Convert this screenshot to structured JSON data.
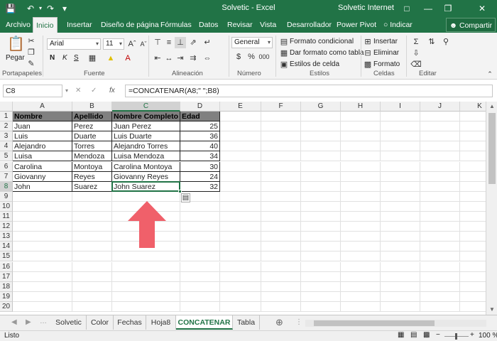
{
  "titlebar": {
    "title": "Solvetic  -  Excel",
    "account": "Solvetic Internet",
    "help_icon": "?",
    "ribbon_display_icon": "ribbon-display-icon"
  },
  "tabs": [
    "Archivo",
    "Inicio",
    "Insertar",
    "Diseño de página",
    "Fórmulas",
    "Datos",
    "Revisar",
    "Vista",
    "Desarrollador",
    "Power Pivot",
    "Indicar"
  ],
  "active_tab": "Inicio",
  "share_label": "Compartir",
  "ribbon": {
    "clipboard": {
      "paste": "Pegar",
      "label": "Portapapeles"
    },
    "font": {
      "name": "Arial",
      "size": "11",
      "bold": "N",
      "italic": "K",
      "underline": "S",
      "label": "Fuente"
    },
    "alignment": {
      "label": "Alineación"
    },
    "number": {
      "format": "General",
      "label": "Número"
    },
    "styles": {
      "conditional": "Formato condicional",
      "table": "Dar formato como tabla",
      "cell": "Estilos de celda",
      "label": "Estilos"
    },
    "cells": {
      "insert": "Insertar",
      "delete": "Eliminar",
      "format": "Formato",
      "label": "Celdas"
    },
    "editing": {
      "label": "Editar"
    }
  },
  "formula_bar": {
    "name_box": "C8",
    "fx": "fx",
    "formula": "=CONCATENAR(A8;\" \";B8)"
  },
  "columns": [
    "A",
    "B",
    "C",
    "D",
    "E",
    "F",
    "G",
    "H",
    "I",
    "J",
    "K"
  ],
  "rows": [
    "1",
    "2",
    "3",
    "4",
    "5",
    "6",
    "7",
    "8",
    "9",
    "10",
    "11",
    "12",
    "13",
    "14",
    "15",
    "16",
    "17",
    "18",
    "19",
    "20"
  ],
  "table": {
    "headers": [
      "Nombre",
      "Apellido",
      "Nombre Completo",
      "Edad"
    ],
    "data": [
      [
        "Juan",
        "Perez",
        "Juan Perez",
        "25"
      ],
      [
        "Luis",
        "Duarte",
        "Luis  Duarte",
        "36"
      ],
      [
        "Alejandro",
        "Torres",
        "Alejandro  Torres",
        "40"
      ],
      [
        "Luisa",
        "Mendoza",
        "Luisa  Mendoza",
        "34"
      ],
      [
        "Carolina",
        "Montoya",
        "Carolina  Montoya",
        "30"
      ],
      [
        "Giovanny",
        "Reyes",
        "Giovanny  Reyes",
        "24"
      ],
      [
        "John",
        "Suarez",
        "John  Suarez",
        "32"
      ]
    ]
  },
  "sheets": [
    "Solvetic",
    "Color",
    "Fechas",
    "Hoja8",
    "CONCATENAR",
    "Tabla"
  ],
  "active_sheet": "CONCATENAR",
  "status": {
    "ready": "Listo",
    "zoom": "100 %"
  },
  "colors": {
    "accent": "#217346",
    "arrow": "#f0606a"
  }
}
